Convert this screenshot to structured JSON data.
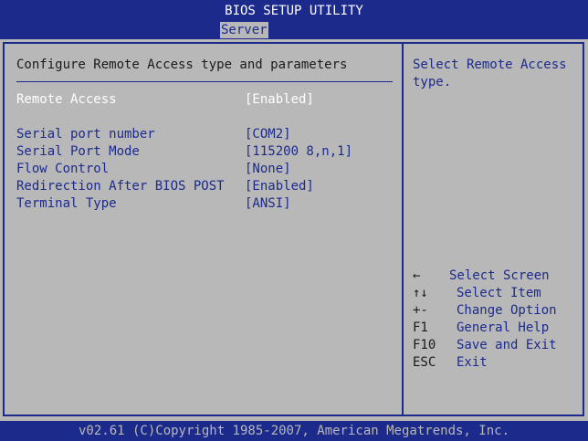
{
  "header": {
    "title": "BIOS SETUP UTILITY",
    "tabs": [
      {
        "label": "Server",
        "active": true
      }
    ]
  },
  "main": {
    "heading": "Configure Remote Access type and parameters",
    "settings": [
      {
        "label": "Remote Access",
        "value": "[Enabled]",
        "selected": true
      },
      {
        "label": "Serial port number",
        "value": "[COM2]",
        "selected": false
      },
      {
        "label": "Serial Port Mode",
        "value": "[115200 8,n,1]",
        "selected": false
      },
      {
        "label": "Flow Control",
        "value": "[None]",
        "selected": false
      },
      {
        "label": "Redirection After BIOS POST",
        "value": "[Enabled]",
        "selected": false
      },
      {
        "label": "Terminal Type",
        "value": "[ANSI]",
        "selected": false
      }
    ]
  },
  "help": {
    "text": "Select Remote Access type.",
    "keys": [
      {
        "key": "←",
        "description": "Select Screen",
        "icon": "left-arrow-icon"
      },
      {
        "key": "↑↓",
        "description": "Select Item",
        "icon": "up-down-arrows-icon"
      },
      {
        "key": "+-",
        "description": "Change Option",
        "icon": "plus-minus-icon"
      },
      {
        "key": "F1",
        "description": "General Help"
      },
      {
        "key": "F10",
        "description": "Save and Exit"
      },
      {
        "key": "ESC",
        "description": "Exit"
      }
    ]
  },
  "footer": {
    "copyright": "v02.61 (C)Copyright 1985-2007, American Megatrends, Inc."
  },
  "colors": {
    "bar_blue": "#1c2a8c",
    "panel_gray": "#b8b8b8",
    "text_blue": "#1c2a8c",
    "highlight_text": "#ffffff"
  }
}
